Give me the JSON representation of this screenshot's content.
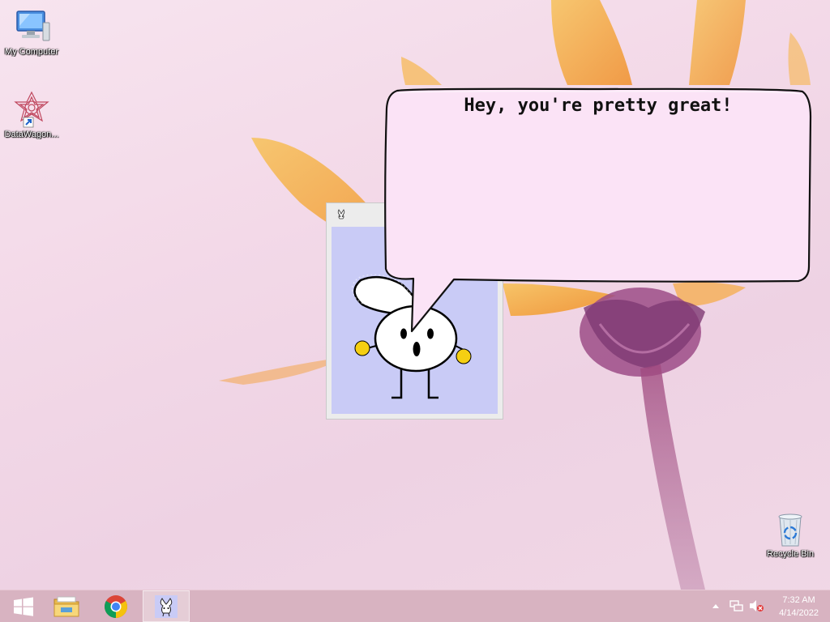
{
  "desktop": {
    "icons": [
      {
        "label": "My Computer",
        "icon": "computer-icon"
      },
      {
        "label": "DataWagon...",
        "icon": "datawagon-shortcut-icon"
      },
      {
        "label": "Recycle Bin",
        "icon": "recycle-bin-icon"
      }
    ]
  },
  "pet": {
    "window_icon": "bunny-icon",
    "bubble_text": "Hey, you're pretty great!"
  },
  "taskbar": {
    "items": [
      {
        "icon": "windows-start-icon"
      },
      {
        "icon": "file-explorer-icon"
      },
      {
        "icon": "chrome-icon"
      },
      {
        "icon": "bunny-app-icon",
        "active": true
      }
    ],
    "tray": {
      "icons": [
        "show-hidden-icons-chevron",
        "network-icon",
        "volume-muted-icon"
      ],
      "time": "7:32 AM",
      "date": "4/14/2022"
    }
  },
  "colors": {
    "taskbar": "#d8b3c1",
    "bubble_fill": "#fbe3f6",
    "pet_bg": "#c9cbf6",
    "petal_orange": "#f4a63a",
    "flower_purple": "#8e4a82"
  }
}
